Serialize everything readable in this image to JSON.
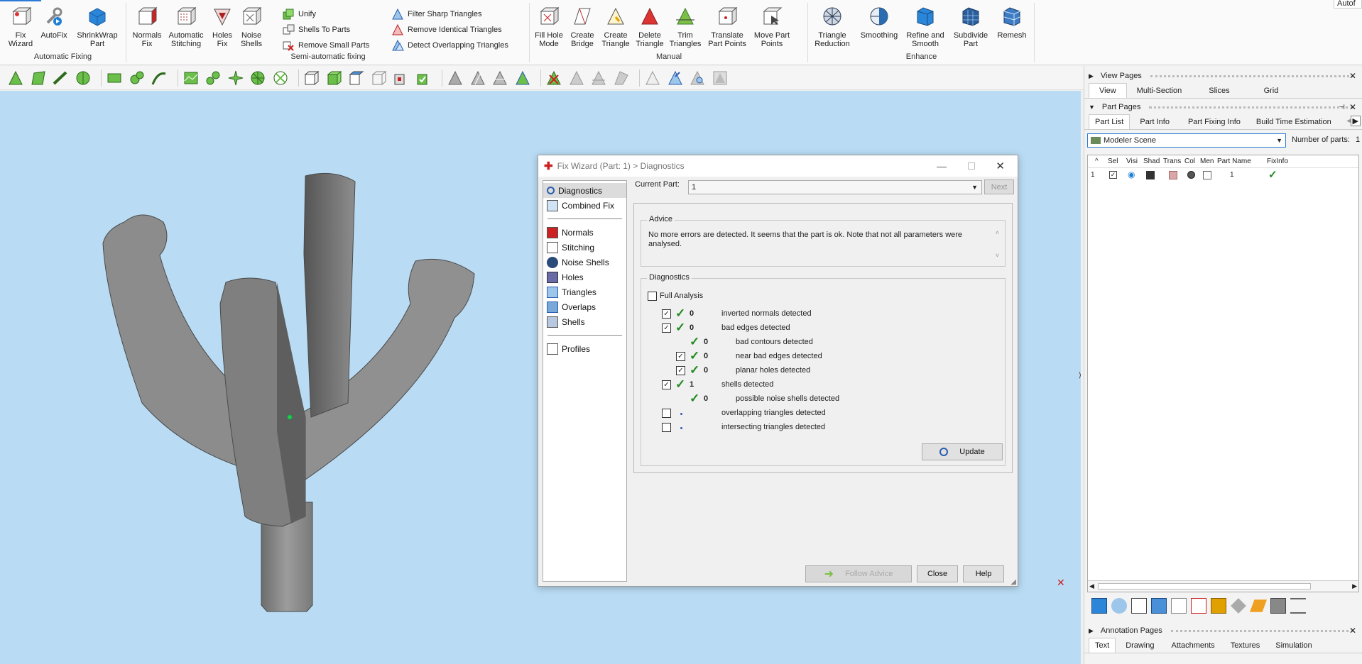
{
  "ribbon": {
    "groups": {
      "automatic_fixing": "Automatic Fixing",
      "semi_automatic": "Semi-automatic fixing",
      "manual": "Manual",
      "enhance": "Enhance"
    },
    "big_buttons": [
      {
        "label1": "Fix",
        "label2": "Wizard"
      },
      {
        "label1": "AutoFix",
        "label2": ""
      },
      {
        "label1": "ShrinkWrap",
        "label2": "Part"
      },
      {
        "label1": "Normals",
        "label2": "Fix"
      },
      {
        "label1": "Automatic",
        "label2": "Stitching"
      },
      {
        "label1": "Holes",
        "label2": "Fix"
      },
      {
        "label1": "Noise",
        "label2": "Shells"
      },
      {
        "label1": "Fill Hole",
        "label2": "Mode"
      },
      {
        "label1": "Create",
        "label2": "Bridge"
      },
      {
        "label1": "Create",
        "label2": "Triangle"
      },
      {
        "label1": "Delete",
        "label2": "Triangle"
      },
      {
        "label1": "Trim",
        "label2": "Triangles"
      },
      {
        "label1": "Translate",
        "label2": "Part Points"
      },
      {
        "label1": "Move Part",
        "label2": "Points"
      },
      {
        "label1": "Triangle",
        "label2": "Reduction"
      },
      {
        "label1": "Smoothing",
        "label2": ""
      },
      {
        "label1": "Refine and",
        "label2": "Smooth"
      },
      {
        "label1": "Subdivide",
        "label2": "Part"
      },
      {
        "label1": "Remesh",
        "label2": ""
      }
    ],
    "small_buttons": [
      "Unify",
      "Shells To Parts",
      "Remove Small Parts",
      "Filter Sharp Triangles",
      "Remove Identical Triangles",
      "Detect Overlapping Triangles"
    ],
    "corner_text": "Autof"
  },
  "right_panel": {
    "view_pages": "View Pages",
    "view_tabs": [
      "View",
      "Multi-Section",
      "Slices",
      "Grid"
    ],
    "part_pages": "Part Pages",
    "part_tabs": [
      "Part List",
      "Part Info",
      "Part Fixing Info",
      "Build Time Estimation"
    ],
    "scene": "Modeler Scene",
    "num_parts_label": "Number of parts:",
    "num_parts_value": "1",
    "columns": [
      "Sel",
      "Visi",
      "Shad",
      "Trans",
      "Col",
      "Men",
      "Part Name",
      "FixInfo"
    ],
    "row": {
      "index": "1",
      "name": "1"
    },
    "annotation_pages": "Annotation Pages",
    "annotation_tabs": [
      "Text",
      "Drawing",
      "Attachments",
      "Textures",
      "Simulation"
    ]
  },
  "dialog": {
    "title": "Fix Wizard (Part: 1) > Diagnostics",
    "nav": [
      "Diagnostics",
      "Combined Fix",
      "Normals",
      "Stitching",
      "Noise Shells",
      "Holes",
      "Triangles",
      "Overlaps",
      "Shells",
      "Profiles"
    ],
    "current_part_label": "Current Part:",
    "current_part_value": "1",
    "next": "Next",
    "advice_label": "Advice",
    "advice_text": "No more errors are detected. It seems that the part is ok. Note that not all parameters were analysed.",
    "diagnostics_label": "Diagnostics",
    "full_analysis": "Full Analysis",
    "items": [
      {
        "count": "0",
        "label": "inverted normals detected"
      },
      {
        "count": "0",
        "label": "bad edges detected"
      },
      {
        "count": "0",
        "label": "bad contours detected"
      },
      {
        "count": "0",
        "label": "near bad edges detected"
      },
      {
        "count": "0",
        "label": "planar holes detected"
      },
      {
        "count": "1",
        "label": "shells detected"
      },
      {
        "count": "0",
        "label": "possible noise shells detected"
      },
      {
        "count": "",
        "label": "overlapping triangles detected"
      },
      {
        "count": "",
        "label": "intersecting triangles detected"
      }
    ],
    "update": "Update",
    "follow_advice": "Follow Advice",
    "close": "Close",
    "help": "Help"
  },
  "colors": {
    "viewport": "#b9dcf4",
    "model": "#8a8a8a",
    "accent": "#1f8a1f"
  }
}
